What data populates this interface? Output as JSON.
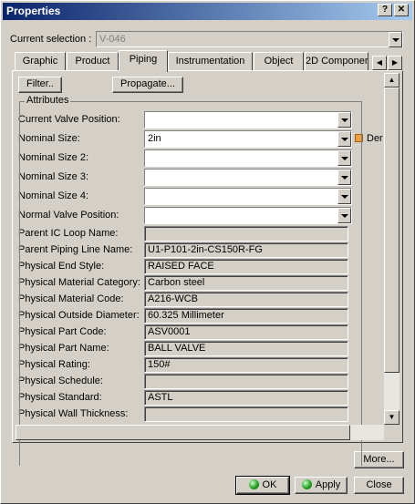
{
  "window": {
    "title": "Properties",
    "help_label": "?",
    "close_label": "✕"
  },
  "current_selection": {
    "label": "Current selection :",
    "value": "V-046"
  },
  "tabs": [
    {
      "label": "Graphic"
    },
    {
      "label": "Product"
    },
    {
      "label": "Piping"
    },
    {
      "label": "Instrumentation"
    },
    {
      "label": "Object"
    },
    {
      "label": "2D Componer"
    }
  ],
  "tab_scroll": {
    "left": "◀",
    "right": "▶"
  },
  "toolbar": {
    "filter_label": "Filter..",
    "propagate_label": "Propagate..."
  },
  "attributes": {
    "title": "Attributes",
    "current_valve_position": {
      "label": "Current Valve Position:",
      "value": ""
    },
    "nominal_size": {
      "label": "Nominal Size:",
      "value": "2in",
      "extra": "Der"
    },
    "nominal_size_2": {
      "label": "Nominal Size 2:",
      "value": ""
    },
    "nominal_size_3": {
      "label": "Nominal Size 3:",
      "value": ""
    },
    "nominal_size_4": {
      "label": "Nominal Size 4:",
      "value": ""
    },
    "normal_valve_position": {
      "label": "Normal Valve Position:",
      "value": ""
    },
    "parent_ic_loop_name": {
      "label": "Parent IC Loop Name:",
      "value": ""
    },
    "parent_piping_line_name": {
      "label": "Parent Piping Line Name:",
      "value": "U1-P101-2in-CS150R-FG"
    },
    "physical_end_style": {
      "label": "Physical End Style:",
      "value": "RAISED FACE"
    },
    "physical_material_category": {
      "label": "Physical Material Category:",
      "value": "Carbon steel"
    },
    "physical_material_code": {
      "label": "Physical Material Code:",
      "value": "A216-WCB"
    },
    "physical_outside_diameter": {
      "label": "Physical Outside Diameter:",
      "value": "60.325 Millimeter"
    },
    "physical_part_code": {
      "label": "Physical Part Code:",
      "value": "ASV0001"
    },
    "physical_part_name": {
      "label": "Physical Part Name:",
      "value": "BALL VALVE"
    },
    "physical_rating": {
      "label": "Physical Rating:",
      "value": "150#"
    },
    "physical_schedule": {
      "label": "Physical Schedule:",
      "value": ""
    },
    "physical_standard": {
      "label": "Physical Standard:",
      "value": "ASTL"
    },
    "physical_wall_thickness": {
      "label": "Physical Wall Thickness:",
      "value": ""
    }
  },
  "scroll": {
    "up": "▲",
    "down": "▼"
  },
  "footer": {
    "more_label": "More...",
    "ok_label": "OK",
    "apply_label": "Apply",
    "close_label": "Close"
  }
}
